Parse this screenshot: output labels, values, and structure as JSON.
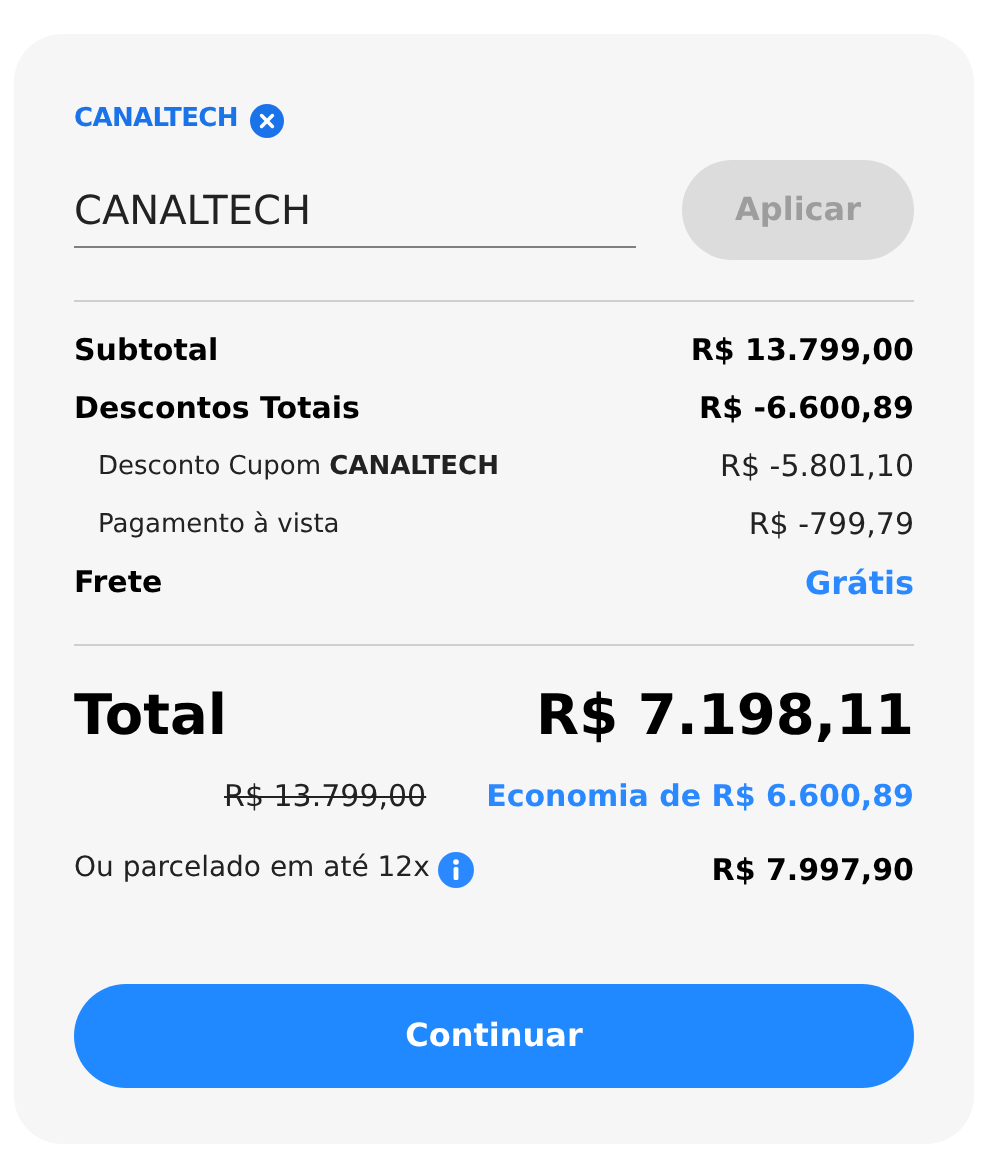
{
  "coupon": {
    "applied_code": "CANALTECH",
    "input": {
      "value": "CANALTECH"
    },
    "apply_button": {
      "label": "Aplicar",
      "disabled": true
    }
  },
  "summary_rows": [
    {
      "kind": "main",
      "label": "Subtotal",
      "value": "R$ 13.799,00"
    },
    {
      "kind": "main",
      "label": "Descontos Totais",
      "value": "R$ -6.600,89"
    },
    {
      "kind": "sub",
      "label": "Desconto Cupom **CANALTECH**",
      "value": "R$ -5.801,10"
    },
    {
      "kind": "sub",
      "label": "Pagamento à vista",
      "value": "R$ -799,79"
    },
    {
      "kind": "highlight",
      "label": "Frete",
      "value": "Grátis"
    }
  ],
  "total": {
    "label": "Total",
    "value": "R$ 7.198,11",
    "original_price": "R$ 13.799,00",
    "savings": "Economia de R$ 6.600,89"
  },
  "installments": {
    "label": "Ou parcelado em até 12x",
    "value": "R$ 7.997,90"
  },
  "continue_button": {
    "label": "Continuar",
    "disabled": false
  }
}
